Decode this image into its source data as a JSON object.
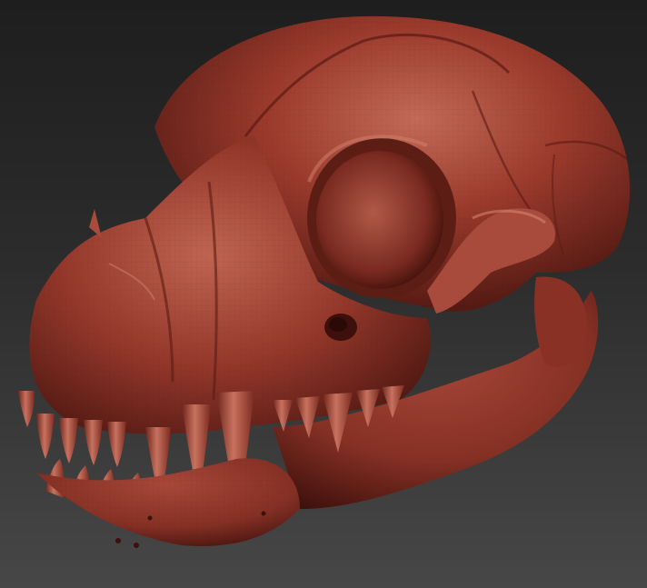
{
  "viewport": {
    "background_top": "#1e1e1e",
    "background_bottom": "#474747"
  },
  "model": {
    "subject": "skull-icon",
    "material_color": "#9b3a2c",
    "highlight_color": "#c46a57",
    "shadow_color": "#4a1510"
  }
}
